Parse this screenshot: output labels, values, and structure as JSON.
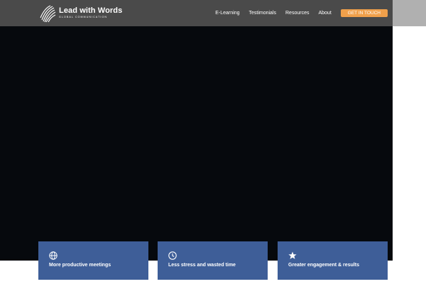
{
  "brand": {
    "name": "Lead with Words",
    "tagline": "GLOBAL COMMUNICATION"
  },
  "nav": {
    "items": [
      {
        "label": "E-Learning"
      },
      {
        "label": "Testimonials"
      },
      {
        "label": "Resources"
      },
      {
        "label": "About"
      }
    ],
    "cta_label": "GET IN TOUCH"
  },
  "cards": [
    {
      "icon": "globe-icon",
      "label": "More productive meetings"
    },
    {
      "icon": "clock-icon",
      "label": "Less stress and wasted time"
    },
    {
      "icon": "star-icon",
      "label": "Greater engagement & results"
    }
  ],
  "colors": {
    "header_bg": "#4a4a4a",
    "hero_bg": "#06090d",
    "cta": "#f0a04b",
    "card_bg": "#3e5e98"
  }
}
